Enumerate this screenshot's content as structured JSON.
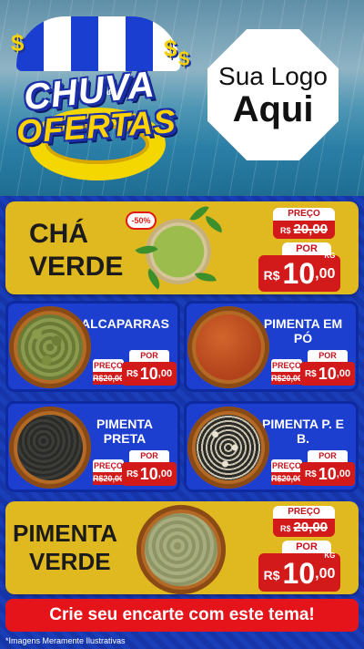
{
  "header": {
    "brand_line1": "CHUVA",
    "brand_de": "de",
    "brand_line2": "OFERTAS",
    "logo_line1": "Sua Logo",
    "logo_line2": "Aqui",
    "dollar_symbol": "$"
  },
  "featured1": {
    "name_line1": "CHÁ",
    "name_line2": "VERDE",
    "discount": "-50%",
    "preco_label": "PREÇO",
    "old_currency": "R$",
    "old_price": "20,00",
    "por_label": "POR",
    "currency": "R$",
    "price_int": "10",
    "price_dec": ",00",
    "unit": "KG"
  },
  "products": [
    {
      "name": "ALCAPARRAS",
      "preco_label": "PREÇO",
      "old_price": "R$20,00",
      "por_label": "POR",
      "currency": "R$",
      "price_int": "10",
      "price_dec": ",00"
    },
    {
      "name": "PIMENTA EM PÓ",
      "preco_label": "PREÇO",
      "old_price": "R$20,00",
      "por_label": "POR",
      "currency": "R$",
      "price_int": "10",
      "price_dec": ",00"
    },
    {
      "name": "PIMENTA PRETA",
      "preco_label": "PREÇO",
      "old_price": "R$20,00",
      "por_label": "POR",
      "currency": "R$",
      "price_int": "10",
      "price_dec": ",00"
    },
    {
      "name": "PIMENTA P. E B.",
      "preco_label": "PREÇO",
      "old_price": "R$20,00",
      "por_label": "POR",
      "currency": "R$",
      "price_int": "10",
      "price_dec": ",00"
    }
  ],
  "featured2": {
    "name_line1": "PIMENTA",
    "name_line2": "VERDE",
    "preco_label": "PREÇO",
    "old_currency": "R$",
    "old_price": "20,00",
    "por_label": "POR",
    "currency": "R$",
    "price_int": "10",
    "price_dec": ",00",
    "unit": "KG"
  },
  "cta": "Crie seu encarte com este tema!",
  "footnote": "*Imagens Meramente Ilustrativas",
  "colors": {
    "brand_blue": "#1d3fd0",
    "card_yellow": "#e0b81f",
    "price_red": "#d31a1a"
  }
}
